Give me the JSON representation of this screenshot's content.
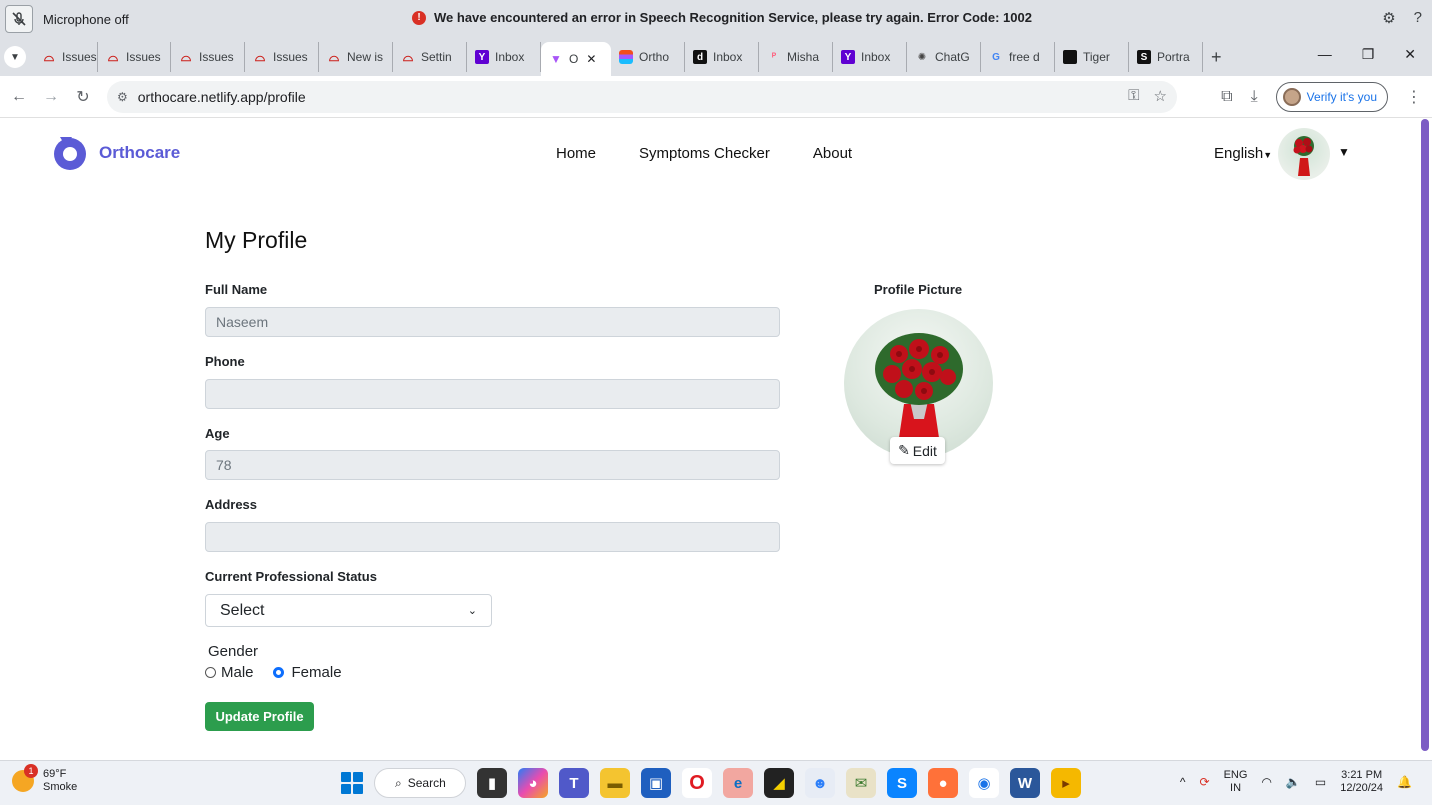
{
  "notification": {
    "mic_label": "Microphone off",
    "message": "We have encountered an error in Speech Recognition Service, please try again. Error Code: 1002"
  },
  "tabs": [
    {
      "label": "Issues",
      "icon": "github-octocat-icon"
    },
    {
      "label": "Issues",
      "icon": "github-octocat-icon"
    },
    {
      "label": "Issues",
      "icon": "github-octocat-icon"
    },
    {
      "label": "Issues",
      "icon": "github-octocat-icon"
    },
    {
      "label": "New is",
      "icon": "github-octocat-icon"
    },
    {
      "label": "Settin",
      "icon": "github-octocat-icon"
    },
    {
      "label": "Inbox",
      "icon": "yahoo-mail-icon"
    },
    {
      "label": "O",
      "icon": "vite-icon",
      "active": true
    },
    {
      "label": "Ortho",
      "icon": "figma-icon"
    },
    {
      "label": "Inbox",
      "icon": "inbox-app-icon"
    },
    {
      "label": "Misha",
      "icon": "pinterest-icon"
    },
    {
      "label": "Inbox",
      "icon": "yahoo-mail-icon"
    },
    {
      "label": "ChatG",
      "icon": "chatgpt-icon"
    },
    {
      "label": "free d",
      "icon": "google-icon"
    },
    {
      "label": "Tiger",
      "icon": "tiger-icon"
    },
    {
      "label": "Portra",
      "icon": "s-app-icon"
    }
  ],
  "address": {
    "url": "orthocare.netlify.app/profile",
    "verify_label": "Verify it's you"
  },
  "site": {
    "brand": "Orthocare",
    "nav": [
      "Home",
      "Symptoms Checker",
      "About"
    ],
    "language": "English"
  },
  "profile": {
    "title": "My Profile",
    "full_name_label": "Full Name",
    "full_name_value": "Naseem",
    "phone_label": "Phone",
    "phone_value": "",
    "age_label": "Age",
    "age_value": "78",
    "address_label": "Address",
    "address_value": "",
    "status_label": "Current Professional Status",
    "status_selected": "Select",
    "gender_label": "Gender",
    "gender_options": [
      "Male",
      "Female"
    ],
    "gender_selected": "Female",
    "update_label": "Update Profile",
    "picture_label": "Profile Picture",
    "edit_label": "Edit"
  },
  "taskbar": {
    "weather_temp": "69°F",
    "weather_desc": "Smoke",
    "weather_badge": "1",
    "search_label": "Search",
    "lang_top": "ENG",
    "lang_bottom": "IN",
    "time": "3:21 PM",
    "date": "12/20/24"
  },
  "colors": {
    "brand": "#5b5bd6",
    "update_button": "#2c9d4d",
    "radio_checked": "#0d6efd",
    "error": "#d93025"
  }
}
